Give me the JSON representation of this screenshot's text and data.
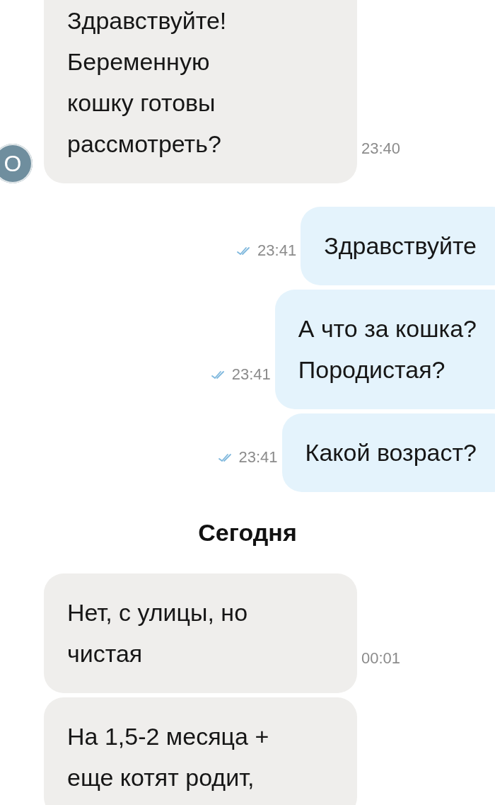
{
  "messages": [
    {
      "kind": "incoming",
      "lines": [
        "Здравствуйте!",
        "Беременную",
        "кошку готовы",
        "рассмотреть?"
      ],
      "time": "23:40",
      "avatar": "О"
    },
    {
      "kind": "outgoing",
      "lines": [
        "Здравствуйте"
      ],
      "time": "23:41",
      "read": true
    },
    {
      "kind": "outgoing",
      "lines": [
        "А что за кошка?",
        "Породистая?"
      ],
      "time": "23:41",
      "read": true
    },
    {
      "kind": "outgoing",
      "lines": [
        "Какой возраст?"
      ],
      "time": "23:41",
      "read": true
    },
    {
      "kind": "date",
      "label": "Сегодня"
    },
    {
      "kind": "incoming",
      "lines": [
        "Нет, с улицы, но",
        "чистая"
      ],
      "time": "00:01"
    },
    {
      "kind": "incoming",
      "lines": [
        "На 1,5-2 месяца +",
        "еще котят родит,"
      ]
    }
  ]
}
